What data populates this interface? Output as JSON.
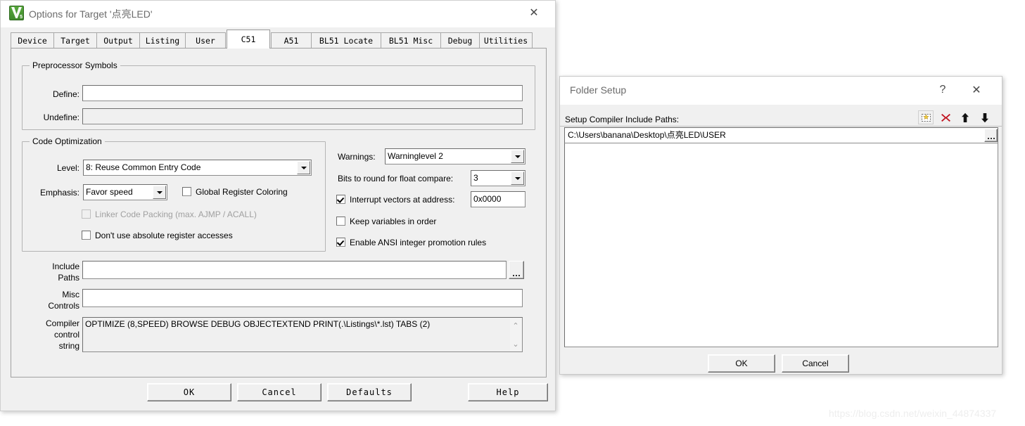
{
  "main_dialog": {
    "title": "Options for Target '点亮LED'",
    "icon": "keil-uvision-v5-icon",
    "close_label": "✕",
    "tabs": [
      {
        "label": "Device",
        "selected": false
      },
      {
        "label": "Target",
        "selected": false
      },
      {
        "label": "Output",
        "selected": false
      },
      {
        "label": "Listing",
        "selected": false
      },
      {
        "label": "User",
        "selected": false
      },
      {
        "label": "C51",
        "selected": true
      },
      {
        "label": "A51",
        "selected": false
      },
      {
        "label": "BL51 Locate",
        "selected": false
      },
      {
        "label": "BL51 Misc",
        "selected": false
      },
      {
        "label": "Debug",
        "selected": false
      },
      {
        "label": "Utilities",
        "selected": false
      }
    ],
    "preprocessor": {
      "group_label": "Preprocessor Symbols",
      "define_label": "Define:",
      "define_value": "",
      "undefine_label": "Undefine:",
      "undefine_value": ""
    },
    "code_optimization": {
      "group_label": "Code Optimization",
      "level_label": "Level:",
      "level_value": "8: Reuse Common Entry Code",
      "emphasis_label": "Emphasis:",
      "emphasis_value": "Favor speed",
      "global_register_coloring": {
        "label": "Global Register Coloring",
        "checked": false,
        "enabled": true
      },
      "linker_code_packing": {
        "label": "Linker Code Packing (max. AJMP / ACALL)",
        "checked": false,
        "enabled": false
      },
      "dont_use_absolute": {
        "label": "Don't use absolute register accesses",
        "checked": false,
        "enabled": true
      }
    },
    "right_options": {
      "warnings_label": "Warnings:",
      "warnings_value": "Warninglevel 2",
      "bits_label": "Bits to round for float compare:",
      "bits_value": "3",
      "interrupt_vectors": {
        "label": "Interrupt vectors at address:",
        "checked": true,
        "value": "0x0000"
      },
      "keep_variables": {
        "label": "Keep variables in order",
        "checked": false
      },
      "ansi_promotion": {
        "label": "Enable ANSI integer promotion rules",
        "checked": true
      }
    },
    "bottom_fields": {
      "include_paths_label_1": "Include",
      "include_paths_label_2": "Paths",
      "include_paths_value": "",
      "browse_button": "...",
      "misc_controls_label_1": "Misc",
      "misc_controls_label_2": "Controls",
      "misc_controls_value": "",
      "compiler_label_1": "Compiler",
      "compiler_label_2": "control",
      "compiler_label_3": "string",
      "compiler_value": "OPTIMIZE (8,SPEED) BROWSE DEBUG OBJECTEXTEND PRINT(.\\Listings\\*.lst) TABS (2)",
      "scroll_up": "⌃",
      "scroll_down": "⌄"
    },
    "buttons": {
      "ok": "OK",
      "cancel": "Cancel",
      "defaults": "Defaults",
      "help": "Help"
    }
  },
  "folder_setup_dialog": {
    "title": "Folder Setup",
    "help_label": "?",
    "close_label": "✕",
    "bar_label": "Setup Compiler Include Paths:",
    "toolbar": [
      {
        "name": "new-folder-icon",
        "tooltip": "New (Insert)"
      },
      {
        "name": "delete-icon",
        "tooltip": "Delete"
      },
      {
        "name": "move-up-icon",
        "tooltip": "Move Up"
      },
      {
        "name": "move-down-icon",
        "tooltip": "Move Down"
      }
    ],
    "paths": [
      "C:\\Users\\banana\\Desktop\\点亮LED\\USER"
    ],
    "browse_button": "...",
    "buttons": {
      "ok": "OK",
      "cancel": "Cancel"
    }
  },
  "watermark": "https://blog.csdn.net/weixin_44874337",
  "colors": {
    "dialog_bg": "#f0f0f0",
    "titlebar_bg": "#ffffff",
    "field_bg": "#ffffff",
    "disabled_text": "#a0a0a0",
    "delete_icon": "#c1121f",
    "keil_green": "#3f8a2b"
  }
}
